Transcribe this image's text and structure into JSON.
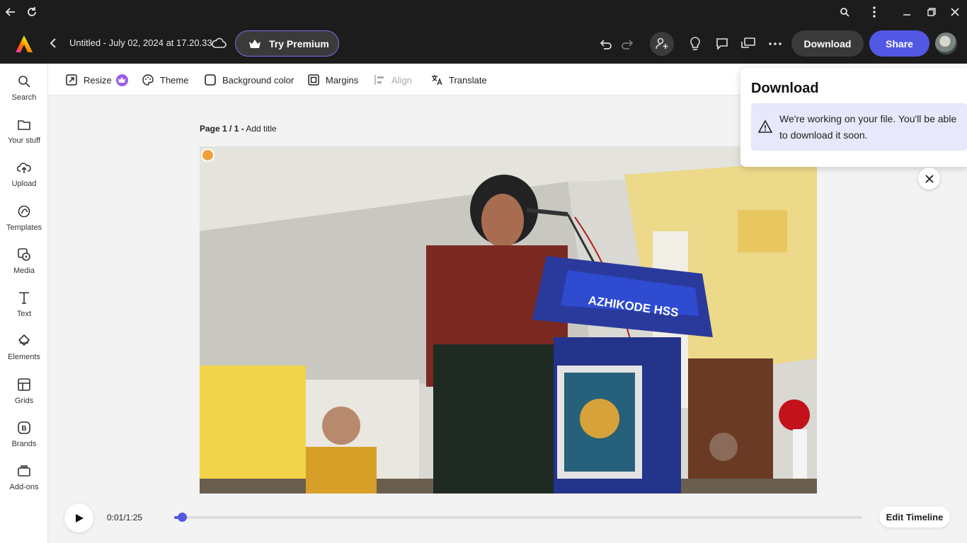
{
  "header": {
    "doc_title": "Untitled - July 02, 2024 at 17.20.33",
    "try_premium": "Try Premium",
    "download": "Download",
    "share": "Share"
  },
  "sidebar": {
    "items": [
      {
        "label": "Search",
        "icon": "search-icon"
      },
      {
        "label": "Your stuff",
        "icon": "folder-icon"
      },
      {
        "label": "Upload",
        "icon": "cloud-upload-icon"
      },
      {
        "label": "Templates",
        "icon": "templates-icon"
      },
      {
        "label": "Media",
        "icon": "media-icon"
      },
      {
        "label": "Text",
        "icon": "text-icon"
      },
      {
        "label": "Elements",
        "icon": "elements-icon"
      },
      {
        "label": "Grids",
        "icon": "grids-icon"
      },
      {
        "label": "Brands",
        "icon": "brands-icon"
      },
      {
        "label": "Add-ons",
        "icon": "add-ons-icon"
      }
    ]
  },
  "toolbar": {
    "resize": "Resize",
    "theme": "Theme",
    "background_color": "Background color",
    "margins": "Margins",
    "align": "Align",
    "translate": "Translate"
  },
  "canvas": {
    "page_number": "Page 1 / 1 -",
    "add_title": "Add title",
    "photo_text": "AZHIKODE HSS"
  },
  "download_panel": {
    "title": "Download",
    "message": "We're working on your file. You'll be able to download it soon."
  },
  "timeline": {
    "time": "0:01/1:25",
    "progress": 0.012,
    "edit_label": "Edit Timeline"
  },
  "colors": {
    "accent": "#5258e4",
    "header_bg": "#1c1c1c",
    "premium": "#9b5de5"
  }
}
